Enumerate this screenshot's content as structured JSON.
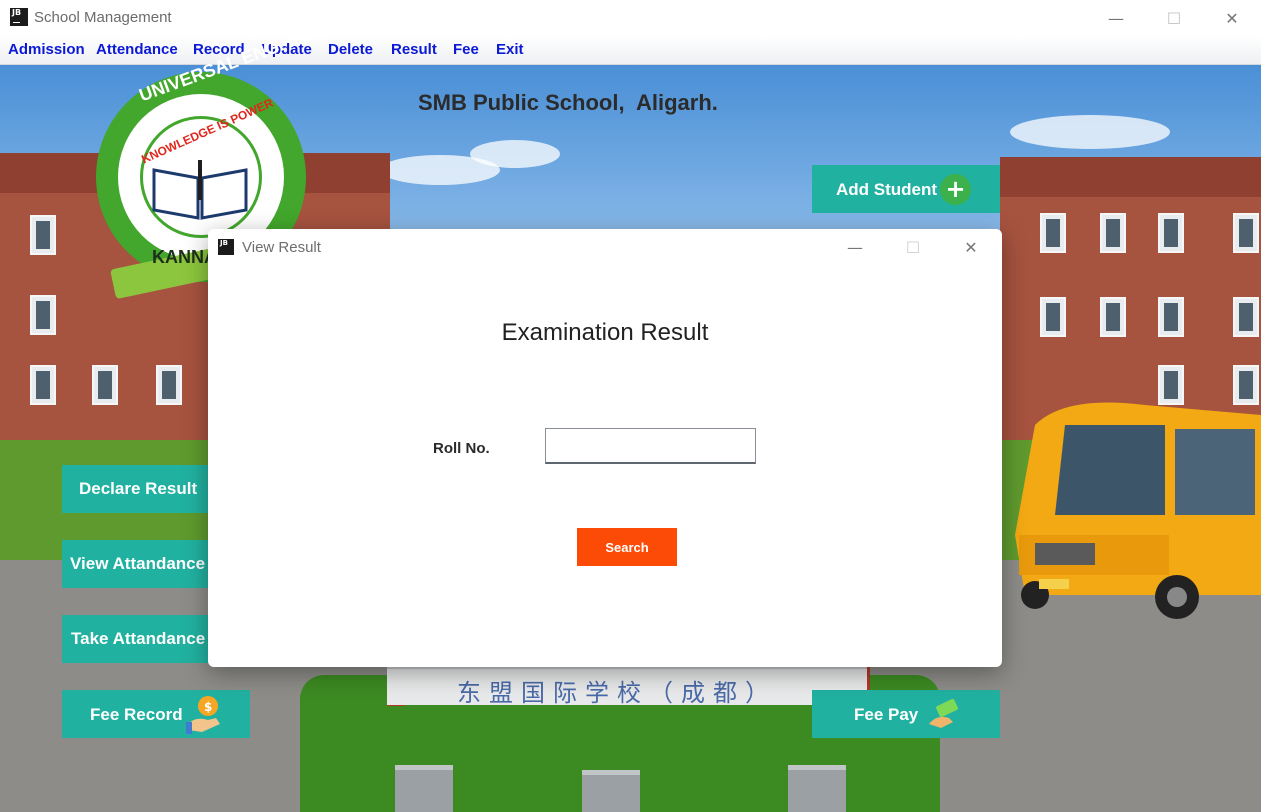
{
  "window": {
    "title": "School Management",
    "icon_text": "JB",
    "controls": {
      "minimize": "—",
      "maximize": "☐",
      "close": "✕"
    }
  },
  "menu": {
    "items": [
      "Admission",
      "Attendance",
      "Record",
      "Update",
      "Delete",
      "Result",
      "Fee",
      "Exit"
    ]
  },
  "background": {
    "school_title": "SMB Public School,  Aligarh.",
    "sign_text": "东盟国际学校（成都）",
    "logo": {
      "top_text": "UNIVERSAL ENG. MED SCH",
      "motto": "KNOWLEDGE IS POWER",
      "bottom_text": "KANNA"
    },
    "buttons": {
      "add_student": "Add Student",
      "declare_result": "Declare Result",
      "view_attendance": "View Attandance",
      "take_attendance": "Take Attandance",
      "fee_record": "Fee Record",
      "fee_pay": "Fee Pay"
    },
    "colors": {
      "button": "#21b1a0",
      "add_icon": "#3cb04a"
    }
  },
  "dialog": {
    "title": "View Result",
    "icon_text": "JB",
    "heading": "Examination Result",
    "roll_label": "Roll No.",
    "roll_value": "",
    "search_label": "Search",
    "colors": {
      "search": "#fb4b07"
    }
  }
}
